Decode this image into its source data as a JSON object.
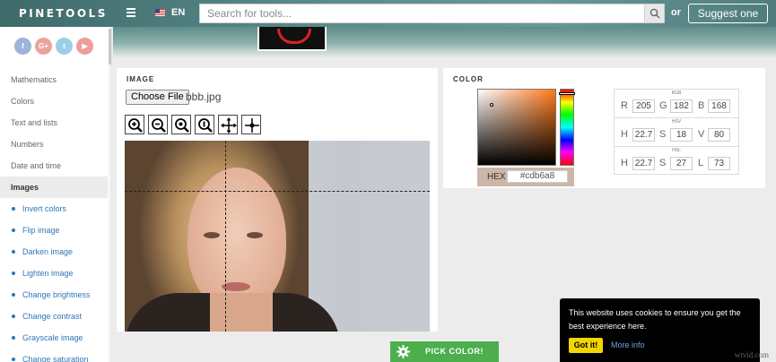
{
  "header": {
    "logo": "PINETOOLS",
    "lang": "EN",
    "search_placeholder": "Search for tools...",
    "or_label": "or",
    "suggest_label": "Suggest one"
  },
  "sidebar": {
    "social": [
      "f",
      "G+",
      "t",
      "▶"
    ],
    "categories": [
      "Mathematics",
      "Colors",
      "Text and lists",
      "Numbers",
      "Date and time",
      "Images"
    ],
    "active_category": "Images",
    "sub_items": [
      "Invert colors",
      "Flip image",
      "Darken image",
      "Lighten image",
      "Change brightness",
      "Change contrast",
      "Grayscale image",
      "Change saturation"
    ]
  },
  "image_panel": {
    "title": "IMAGE",
    "file_button": "Choose File",
    "file_name": "bbb.jpg",
    "tools": [
      "zoom-in-icon",
      "zoom-out-icon",
      "zoom-reset-icon",
      "zoom-fit-icon",
      "move-icon",
      "crosshair-icon"
    ]
  },
  "color_panel": {
    "title": "COLOR",
    "hex_label": "HEX",
    "hex_value": "#cdb6a8",
    "hex_color": "#cdb6a8",
    "rgb": {
      "title": "RGB",
      "labels": [
        "R",
        "G",
        "B"
      ],
      "values": [
        "205",
        "182",
        "168"
      ]
    },
    "hsv": {
      "title": "HSV",
      "labels": [
        "H",
        "S",
        "V"
      ],
      "values": [
        "22.7",
        "18",
        "80"
      ]
    },
    "hsl": {
      "title": "HSL",
      "labels": [
        "H",
        "S",
        "L"
      ],
      "values": [
        "22.7",
        "27",
        "73"
      ]
    }
  },
  "pick_button": "PICK COLOR!",
  "cookie": {
    "text": "This website uses cookies to ensure you get the best experience here.",
    "got_it": "Got it!",
    "more_info": "More info"
  },
  "watermark": "wtvid.com"
}
